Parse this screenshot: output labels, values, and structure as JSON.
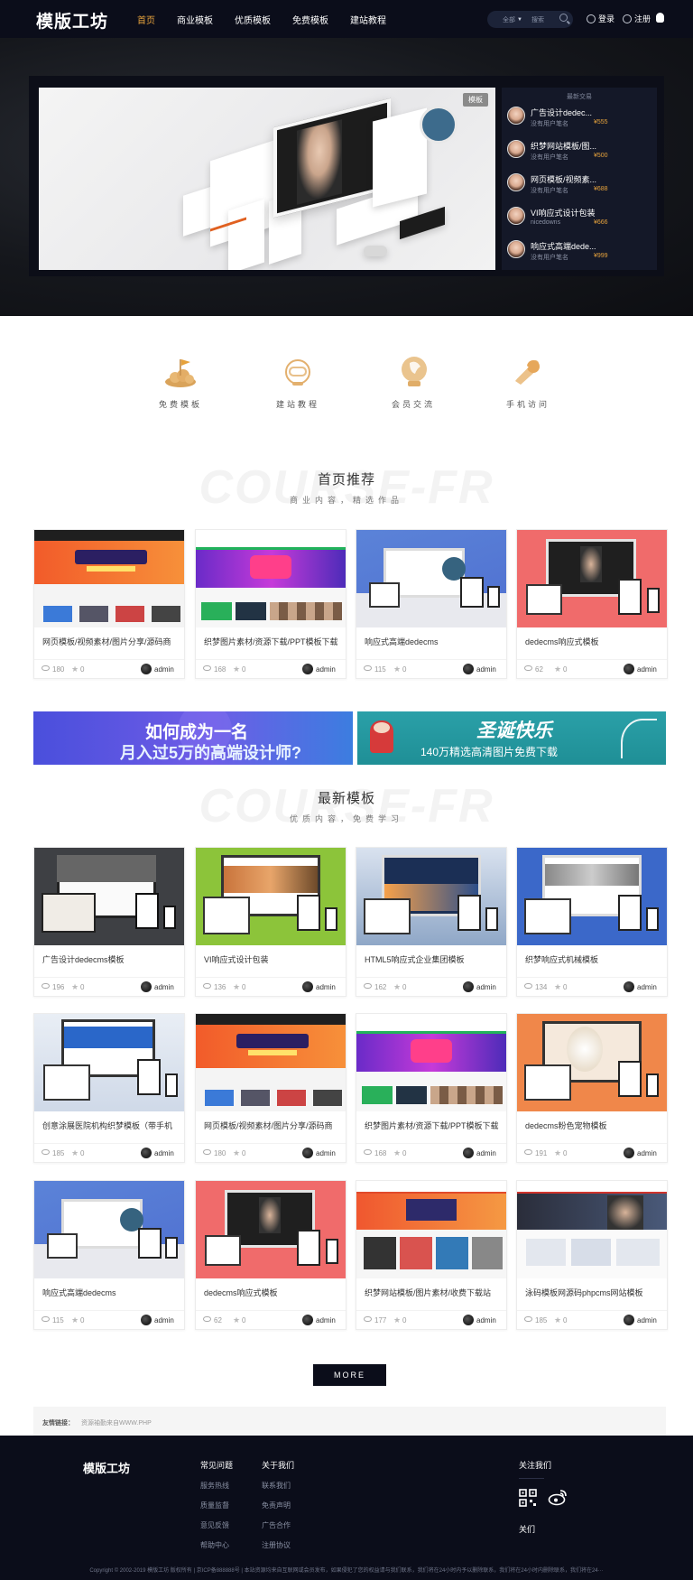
{
  "header": {
    "logo": "模版工坊",
    "nav": [
      "首页",
      "商业模板",
      "优质模板",
      "免费模板",
      "建站教程"
    ],
    "search": {
      "scope": "全部",
      "placeholder": "搜索"
    },
    "login": "登录",
    "register": "注册",
    "accent": "#e6a23c"
  },
  "hero": {
    "badge": "模板",
    "sidebar_title": "最新交易",
    "deals": [
      {
        "title": "广告设计dedec...",
        "sub": "没有用户笔名",
        "price": "¥555"
      },
      {
        "title": "织梦网站模板/图...",
        "sub": "没有用户笔名",
        "price": "¥500"
      },
      {
        "title": "网页模板/视频素...",
        "sub": "没有用户笔名",
        "price": "¥688"
      },
      {
        "title": "VI响应式设计包装",
        "sub": "nicedowns",
        "price": "¥666"
      },
      {
        "title": "响应式高端dede...",
        "sub": "没有用户笔名",
        "price": "¥999"
      }
    ]
  },
  "features": [
    "免费模板",
    "建站教程",
    "会员交流",
    "手机访问"
  ],
  "section1": {
    "bg": "COURSE-FR",
    "title": "首页推荐",
    "subtitle": "商业内容，精选作品"
  },
  "section2": {
    "bg": "COURSE-FR",
    "title": "最新模板",
    "subtitle": "优质内容，免费学习"
  },
  "recommended": [
    {
      "title": "网页模板/视频素材/图片分享/源码商",
      "views": "180",
      "likes": "0",
      "user": "admin",
      "thumb": "a"
    },
    {
      "title": "织梦图片素材/资源下载/PPT模板下载",
      "views": "168",
      "likes": "0",
      "user": "admin",
      "thumb": "b"
    },
    {
      "title": "响应式高端dedecms",
      "views": "115",
      "likes": "0",
      "user": "admin",
      "thumb": "c"
    },
    {
      "title": "dedecms响应式模板",
      "views": "62",
      "likes": "0",
      "user": "admin",
      "thumb": "d"
    }
  ],
  "banners": {
    "left_line1": "如何成为一名",
    "left_line2": "月入过5万的高端设计师?",
    "right_line1": "圣诞快乐",
    "right_line2": "140万精选高清图片免费下载"
  },
  "latest": [
    {
      "title": "广告设计dedecms模板",
      "views": "196",
      "likes": "0",
      "user": "admin",
      "thumb": "e"
    },
    {
      "title": "VI响应式设计包装",
      "views": "136",
      "likes": "0",
      "user": "admin",
      "thumb": "f"
    },
    {
      "title": "HTML5响应式企业集团模板",
      "views": "162",
      "likes": "0",
      "user": "admin",
      "thumb": "g"
    },
    {
      "title": "织梦响应式机械模板",
      "views": "134",
      "likes": "0",
      "user": "admin",
      "thumb": "h"
    },
    {
      "title": "创意涂展医院机构织梦模板（带手机",
      "views": "185",
      "likes": "0",
      "user": "admin",
      "thumb": "i"
    },
    {
      "title": "网页模板/视频素材/图片分享/源码商",
      "views": "180",
      "likes": "0",
      "user": "admin",
      "thumb": "a"
    },
    {
      "title": "织梦图片素材/资源下载/PPT模板下载",
      "views": "168",
      "likes": "0",
      "user": "admin",
      "thumb": "b"
    },
    {
      "title": "dedecms粉色宠物模板",
      "views": "191",
      "likes": "0",
      "user": "admin",
      "thumb": "j"
    },
    {
      "title": "响应式高端dedecms",
      "views": "115",
      "likes": "0",
      "user": "admin",
      "thumb": "c"
    },
    {
      "title": "dedecms响应式模板",
      "views": "62",
      "likes": "0",
      "user": "admin",
      "thumb": "d"
    },
    {
      "title": "织梦网站模板/图片素材/收费下载站",
      "views": "177",
      "likes": "0",
      "user": "admin",
      "thumb": "k"
    },
    {
      "title": "泳码模板网源码phpcms网站模板",
      "views": "185",
      "likes": "0",
      "user": "admin",
      "thumb": "l"
    }
  ],
  "more": "MORE",
  "links": {
    "label": "友情链接：",
    "value": "资源袖勤来自WWW.PHP"
  },
  "footer": {
    "logo": "模版工坊",
    "col1_title": "常见问题",
    "col1": [
      "服务热线",
      "质量监督",
      "意见反馈",
      "帮助中心"
    ],
    "col2_title": "关于我们",
    "col2": [
      "联系我们",
      "免责声明",
      "广告合作",
      "注册协议"
    ],
    "follow": "关注我们",
    "guanzhu": "关们",
    "copyright": "Copyright © 2002-2019 模版工坊 版权所有 | 京ICP备888888号 | 本站资源均来自互联网或会员发布，如果侵犯了您的权益请与我们联系，我们将在24小时内予以删除联系，我们将在24小时内删除联系，我们将在24···"
  }
}
